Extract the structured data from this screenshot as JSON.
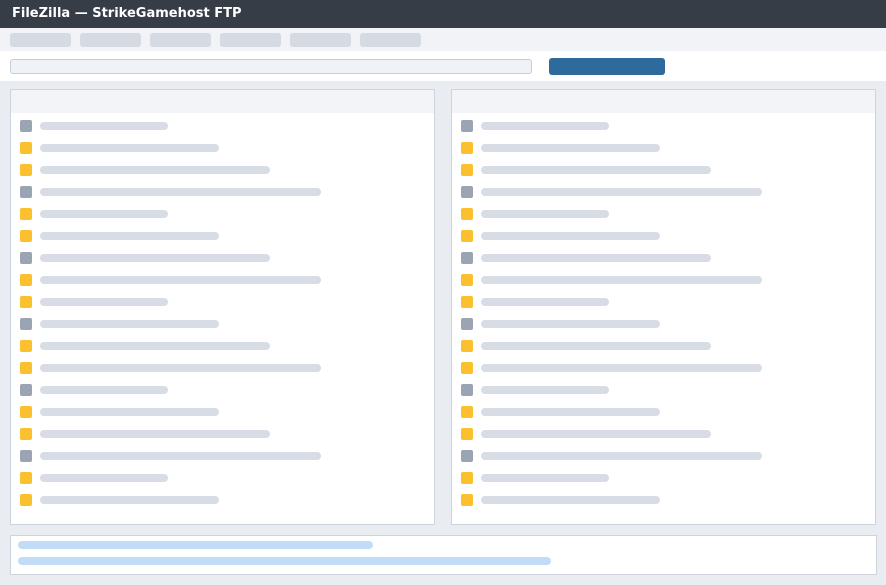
{
  "window": {
    "title": "FileZilla — StrikeGamehost FTP"
  },
  "colors": {
    "titlebar": "#373d47",
    "accent": "#2e6a9c",
    "file_icon": "#fbc02d",
    "folder_icon": "#9aa4b3",
    "log_line": "#c2dcf7"
  },
  "menu": {
    "item_count": 6
  },
  "panes": [
    {
      "id": "local",
      "rows": [
        {
          "icon": "folder-icon"
        },
        {
          "icon": "file-icon"
        },
        {
          "icon": "file-icon"
        },
        {
          "icon": "folder-icon"
        },
        {
          "icon": "file-icon"
        },
        {
          "icon": "file-icon"
        },
        {
          "icon": "folder-icon"
        },
        {
          "icon": "file-icon"
        },
        {
          "icon": "file-icon"
        },
        {
          "icon": "folder-icon"
        },
        {
          "icon": "file-icon"
        },
        {
          "icon": "file-icon"
        },
        {
          "icon": "folder-icon"
        },
        {
          "icon": "file-icon"
        },
        {
          "icon": "file-icon"
        },
        {
          "icon": "folder-icon"
        },
        {
          "icon": "file-icon"
        },
        {
          "icon": "file-icon"
        }
      ]
    },
    {
      "id": "remote",
      "rows": [
        {
          "icon": "folder-icon"
        },
        {
          "icon": "file-icon"
        },
        {
          "icon": "file-icon"
        },
        {
          "icon": "folder-icon"
        },
        {
          "icon": "file-icon"
        },
        {
          "icon": "file-icon"
        },
        {
          "icon": "folder-icon"
        },
        {
          "icon": "file-icon"
        },
        {
          "icon": "file-icon"
        },
        {
          "icon": "folder-icon"
        },
        {
          "icon": "file-icon"
        },
        {
          "icon": "file-icon"
        },
        {
          "icon": "folder-icon"
        },
        {
          "icon": "file-icon"
        },
        {
          "icon": "file-icon"
        },
        {
          "icon": "folder-icon"
        },
        {
          "icon": "file-icon"
        },
        {
          "icon": "file-icon"
        }
      ]
    }
  ],
  "log": {
    "line_count": 2
  }
}
